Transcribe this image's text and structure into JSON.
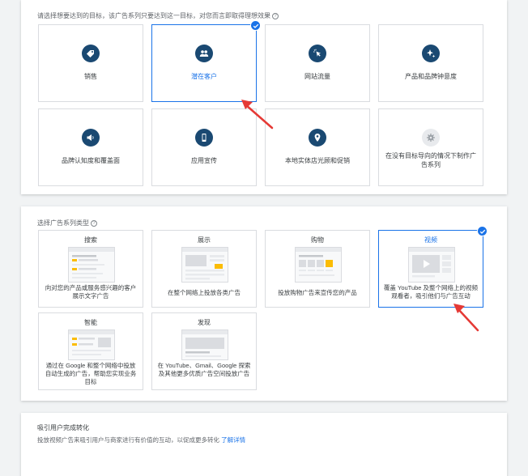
{
  "goal_section": {
    "title": "请选择想要达到的目标，该广告系列只要达到这一目标，对您而言即取得理想效果",
    "help": "?",
    "goals": [
      {
        "label": "销售",
        "icon": "tag-icon"
      },
      {
        "label": "潜在客户",
        "icon": "people-icon",
        "selected": true
      },
      {
        "label": "网站流量",
        "icon": "cursor-click-icon"
      },
      {
        "label": "产品和品牌钟意度",
        "icon": "sparkle-icon"
      },
      {
        "label": "品牌认知度和覆盖面",
        "icon": "megaphone-icon"
      },
      {
        "label": "应用宣传",
        "icon": "phone-icon"
      },
      {
        "label": "本地实体店光顾和促销",
        "icon": "location-pin-icon"
      },
      {
        "label": "在没有目标导向的情况下制作广告系列",
        "icon": "gear-icon"
      }
    ]
  },
  "type_section": {
    "title": "选择广告系列类型",
    "help": "?",
    "types": [
      {
        "name": "搜索",
        "desc": "向对您的产品或服务感兴趣的客户展示文字广告"
      },
      {
        "name": "展示",
        "desc": "在整个网络上投放各类广告"
      },
      {
        "name": "购物",
        "desc": "投放购物广告来宣传您的产品"
      },
      {
        "name": "视频",
        "desc": "覆盖 YouTube 及整个网络上的视频观看者，吸引他们与广告互动",
        "selected": true
      },
      {
        "name": "智能",
        "desc": "通过在 Google 和整个网络中投放自动生成的广告，帮助您实现业务目标"
      },
      {
        "name": "发现",
        "desc": "在 YouTube、Gmail、Google 探索及其他更多优质广告空间投放广告"
      }
    ]
  },
  "conversion_section": {
    "title": "吸引用户完成转化",
    "desc": "投放视频广告来吸引用户与商家进行有价值的互动，以促成更多转化",
    "link": "了解详情"
  },
  "colors": {
    "accent": "#1a73e8",
    "icon_bg": "#1a4972",
    "arrow": "#e53935"
  }
}
